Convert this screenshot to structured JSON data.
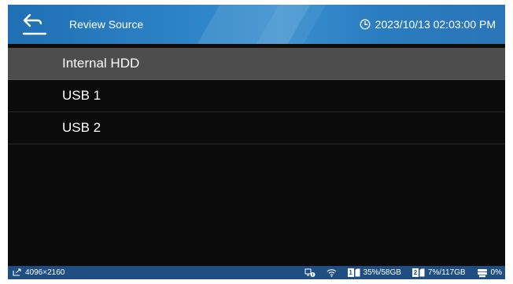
{
  "header": {
    "title": "Review Source",
    "datetime": "2023/10/13 02:03:00 PM",
    "back_icon": "back-arrow-icon",
    "clock_icon": "clock-icon"
  },
  "list": {
    "items": [
      {
        "label": "Internal HDD",
        "selected": true
      },
      {
        "label": "USB 1",
        "selected": false
      },
      {
        "label": "USB 2",
        "selected": false
      }
    ]
  },
  "footer": {
    "resolution": "4096×2160",
    "slot1_number": "1",
    "slot1_usage": "35%/58GB",
    "slot2_number": "2",
    "slot2_usage": "7%/117GB",
    "hdd_usage": "0%",
    "icons": [
      "input-signal-icon",
      "network-icon",
      "wifi-icon",
      "card-icon",
      "hdd-icon"
    ]
  },
  "colors": {
    "header": "#2f86c8",
    "selected_row": "#4d4d4e",
    "footer": "#1f4f82",
    "background": "#0b0b0c"
  }
}
